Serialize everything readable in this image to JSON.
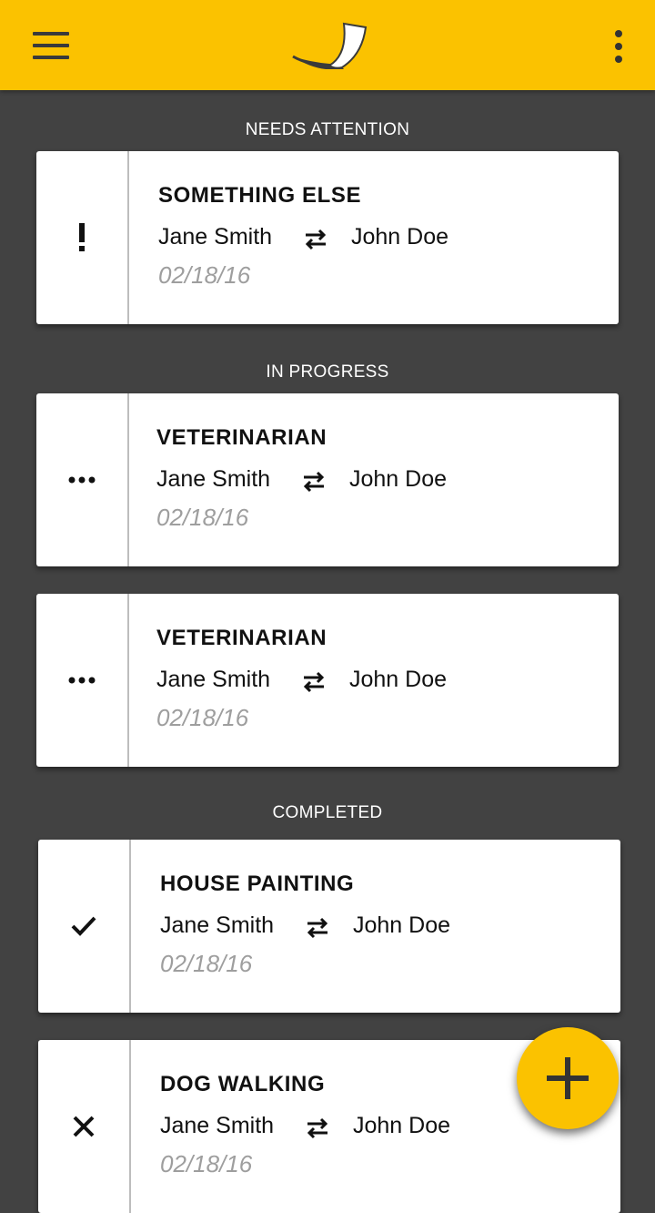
{
  "appbar": {
    "menu_icon": "hamburger-menu-icon",
    "logo_icon": "app-logo-icon",
    "more_icon": "more-vert-icon",
    "background": "#fbc200"
  },
  "sections": {
    "needs_attention": "NEEDS ATTENTION",
    "in_progress": "IN PROGRESS",
    "completed": "COMPLETED"
  },
  "cards": [
    {
      "status": "attention",
      "status_icon": "exclamation-icon",
      "title": "SOMETHING ELSE",
      "from": "Jane Smith",
      "to": "John Doe",
      "date": "02/18/16"
    },
    {
      "status": "in-progress",
      "status_icon": "ellipsis-icon",
      "title": "VETERINARIAN",
      "from": "Jane Smith",
      "to": "John Doe",
      "date": "02/18/16"
    },
    {
      "status": "in-progress",
      "status_icon": "ellipsis-icon",
      "title": "VETERINARIAN",
      "from": "Jane Smith",
      "to": "John Doe",
      "date": "02/18/16"
    },
    {
      "status": "completed",
      "status_icon": "checkmark-icon",
      "title": "HOUSE PAINTING",
      "from": "Jane Smith",
      "to": "John Doe",
      "date": "02/18/16"
    },
    {
      "status": "cancelled",
      "status_icon": "close-icon",
      "title": "DOG WALKING",
      "from": "Jane Smith",
      "to": "John Doe",
      "date": "02/18/16"
    }
  ],
  "swap_icon": "swap-horizontal-icon",
  "fab": {
    "icon": "plus-icon",
    "color": "#fbc200"
  }
}
